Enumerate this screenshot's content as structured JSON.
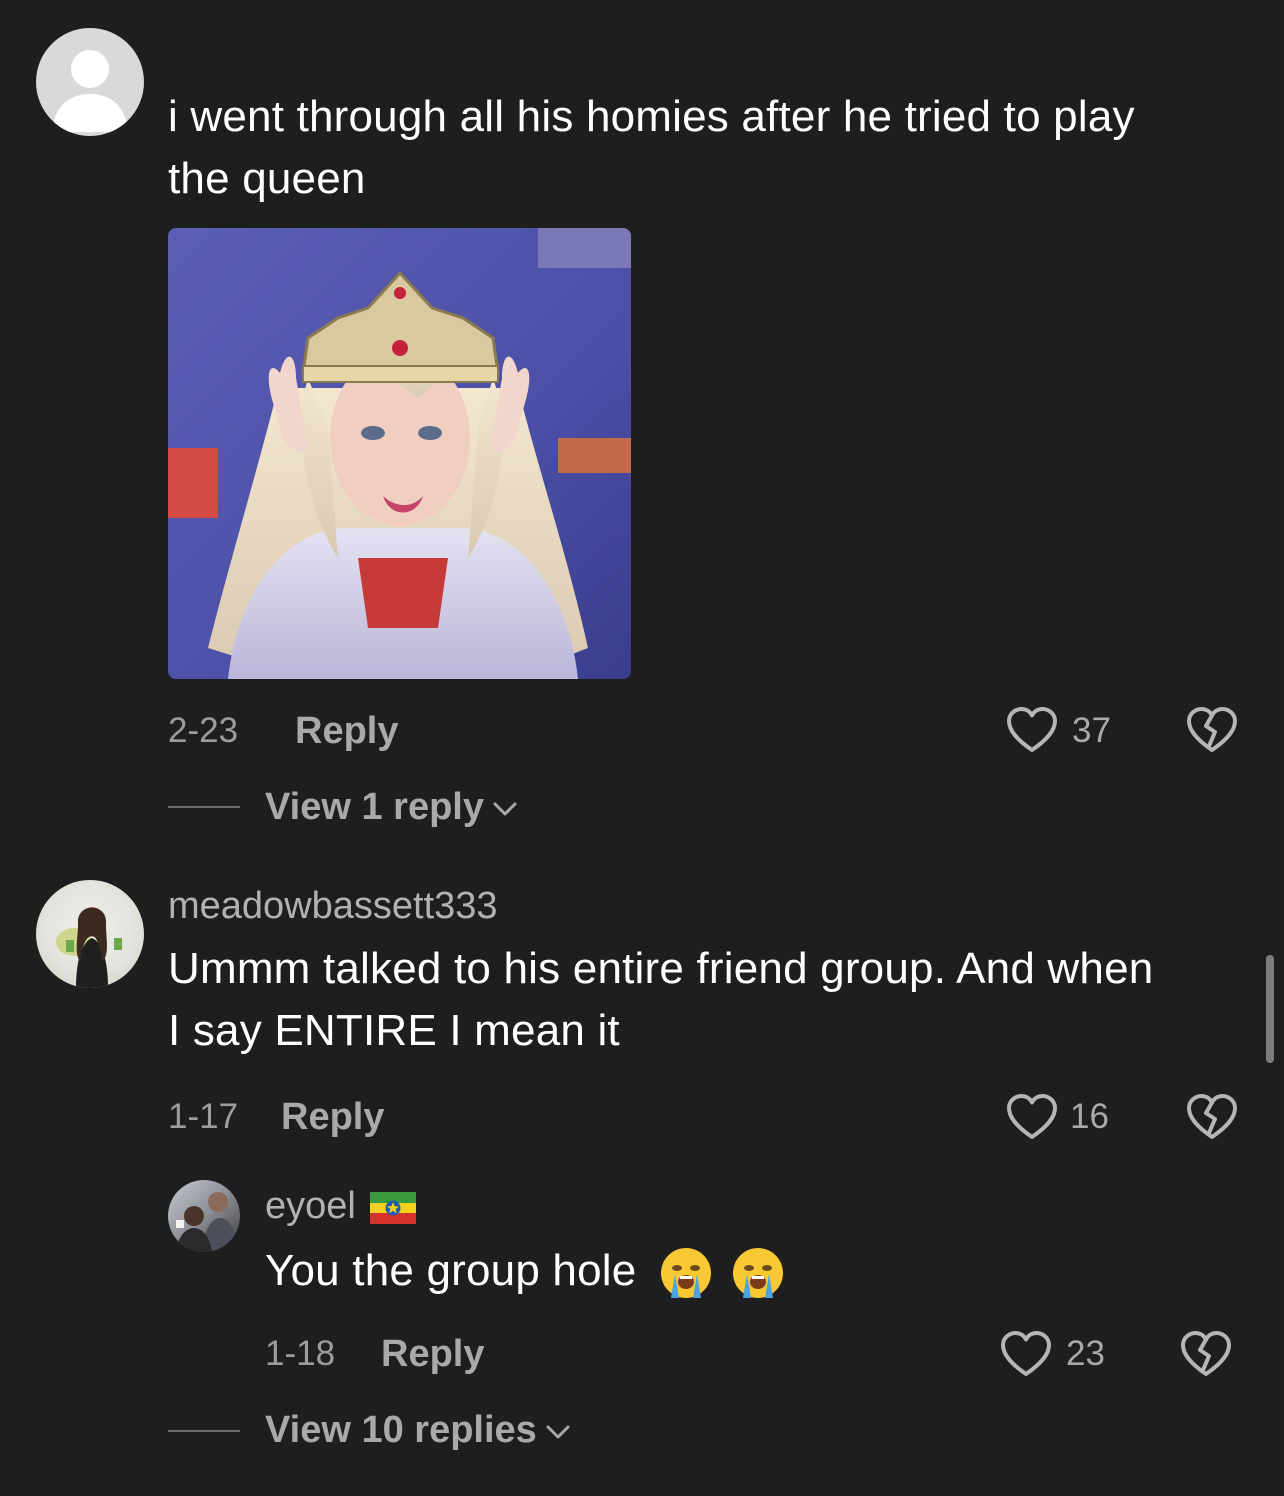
{
  "comments": [
    {
      "text": "i went through all his homies after he tried to play the queen",
      "text_line1": "i went through all his homies after he tried to play",
      "text_line2": "the queen",
      "date": "2-23",
      "reply_label": "Reply",
      "likes": "37",
      "view_replies": "View 1 reply"
    },
    {
      "username": "meadowbassett333",
      "text_line1": "Ummm talked to his entire friend group. And when",
      "text_line2": "I say ENTIRE I mean it",
      "date": "1-17",
      "reply_label": "Reply",
      "likes": "16"
    }
  ],
  "reply": {
    "username": "eyoel",
    "text": "You the group hole",
    "date": "1-18",
    "reply_label": "Reply",
    "likes": "23",
    "view_replies": "View 10 replies"
  },
  "colors": {
    "background": "#1e1e1f",
    "text": "#ffffff",
    "muted": "#a9a9a9"
  },
  "icons": [
    "default-avatar-icon",
    "heart-icon",
    "broken-heart-icon",
    "chevron-down-icon",
    "crying-emoji",
    "ethiopia-flag"
  ]
}
